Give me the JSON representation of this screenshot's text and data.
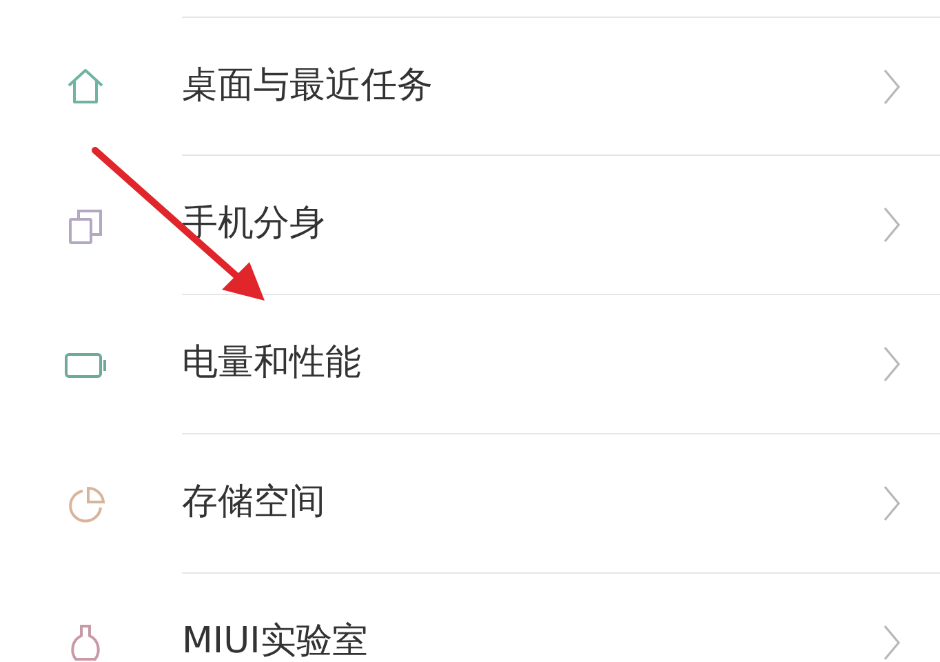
{
  "settings_list": [
    {
      "label": "桌面与最近任务"
    },
    {
      "label": "手机分身"
    },
    {
      "label": "电量和性能"
    },
    {
      "label": "存储空间"
    },
    {
      "label": "MIUI实验室"
    }
  ],
  "annotations": [
    {
      "kind": "arrow"
    }
  ]
}
